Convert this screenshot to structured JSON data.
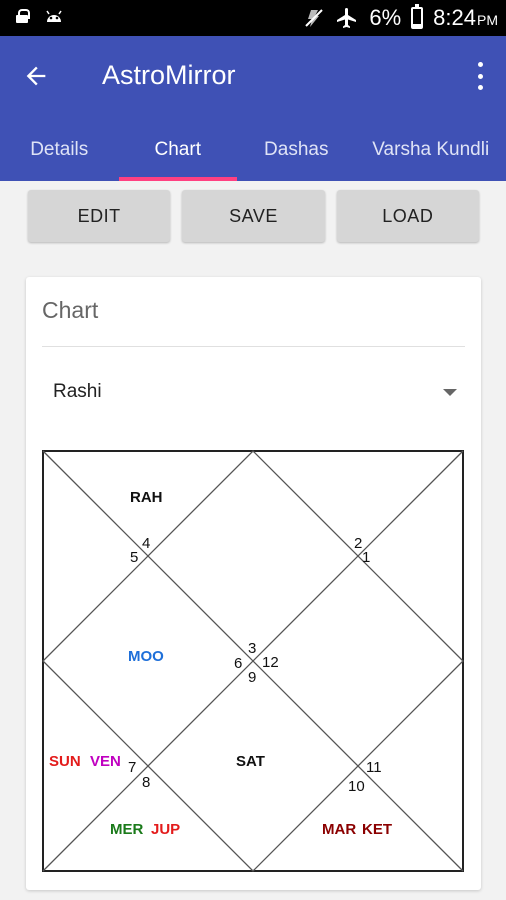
{
  "status_bar": {
    "battery_percent": "6%",
    "time": "8:24",
    "ampm": "PM"
  },
  "app_bar": {
    "title": "AstroMirror"
  },
  "tabs": [
    {
      "label": "Details",
      "active": false
    },
    {
      "label": "Chart",
      "active": true
    },
    {
      "label": "Dashas",
      "active": false
    },
    {
      "label": "Varsha Kundli",
      "active": false
    }
  ],
  "actions": {
    "edit_label": "EDIT",
    "save_label": "SAVE",
    "load_label": "LOAD"
  },
  "card": {
    "title": "Chart",
    "chart_type_selected": "Rashi"
  },
  "kundli": {
    "house_numbers": [
      "4",
      "5",
      "2",
      "1",
      "3",
      "6",
      "12",
      "9",
      "7",
      "8",
      "11",
      "10"
    ],
    "planets": {
      "rah": "RAH",
      "moo": "MOO",
      "sun": "SUN",
      "ven": "VEN",
      "sat": "SAT",
      "mer": "MER",
      "jup": "JUP",
      "mar": "MAR",
      "ket": "KET"
    },
    "colors": {
      "default": "#111111",
      "moon": "#1e6fd9",
      "sun": "#e31b1b",
      "venus": "#c000c0",
      "mercury": "#1a7a1a",
      "jupiter": "#e31b1b",
      "mars": "#8b0000",
      "ketu": "#8b0000"
    }
  }
}
